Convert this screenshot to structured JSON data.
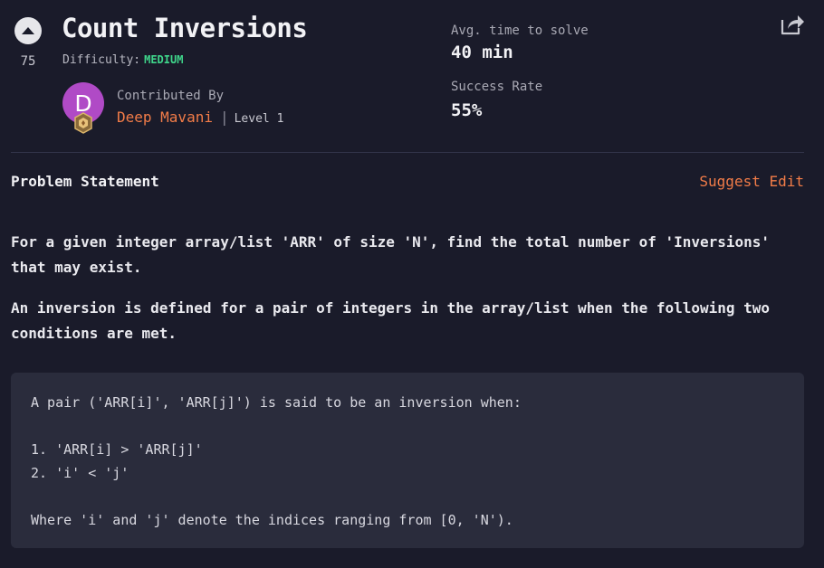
{
  "problem": {
    "title": "Count Inversions",
    "votes": "75",
    "difficulty_label": "Difficulty:",
    "difficulty_value": "MEDIUM"
  },
  "contributor": {
    "label": "Contributed By",
    "avatar_letter": "D",
    "name": "Deep Mavani",
    "separator": "|",
    "level": "Level 1"
  },
  "stats": {
    "avg_time_label": "Avg. time to solve",
    "avg_time_value": "40 min",
    "success_label": "Success Rate",
    "success_value": "55%"
  },
  "section": {
    "title": "Problem Statement",
    "suggest_edit": "Suggest Edit"
  },
  "statement": {
    "para1": "For a given integer array/list 'ARR' of size 'N', find the total number of 'Inversions' that may exist.",
    "para2": "An inversion is defined for a pair of integers in the array/list when the following two conditions are met."
  },
  "code_block": {
    "line1": "A pair ('ARR[i]', 'ARR[j]') is said to be an inversion when:",
    "line2": "",
    "line3": "1. 'ARR[i] > 'ARR[j]'",
    "line4": "2. 'i' < 'j'",
    "line5": "",
    "line6": "Where 'i' and 'j' denote the indices ranging from [0, 'N')."
  },
  "icons": {
    "upvote": "upvote-arrow-icon",
    "badge": "level-badge-icon",
    "share": "share-icon"
  },
  "colors": {
    "background": "#1a1b2a",
    "accent": "#f27c48",
    "difficulty_medium": "#3fd68b",
    "avatar": "#b04ac6",
    "code_background": "#2a2c3c"
  }
}
